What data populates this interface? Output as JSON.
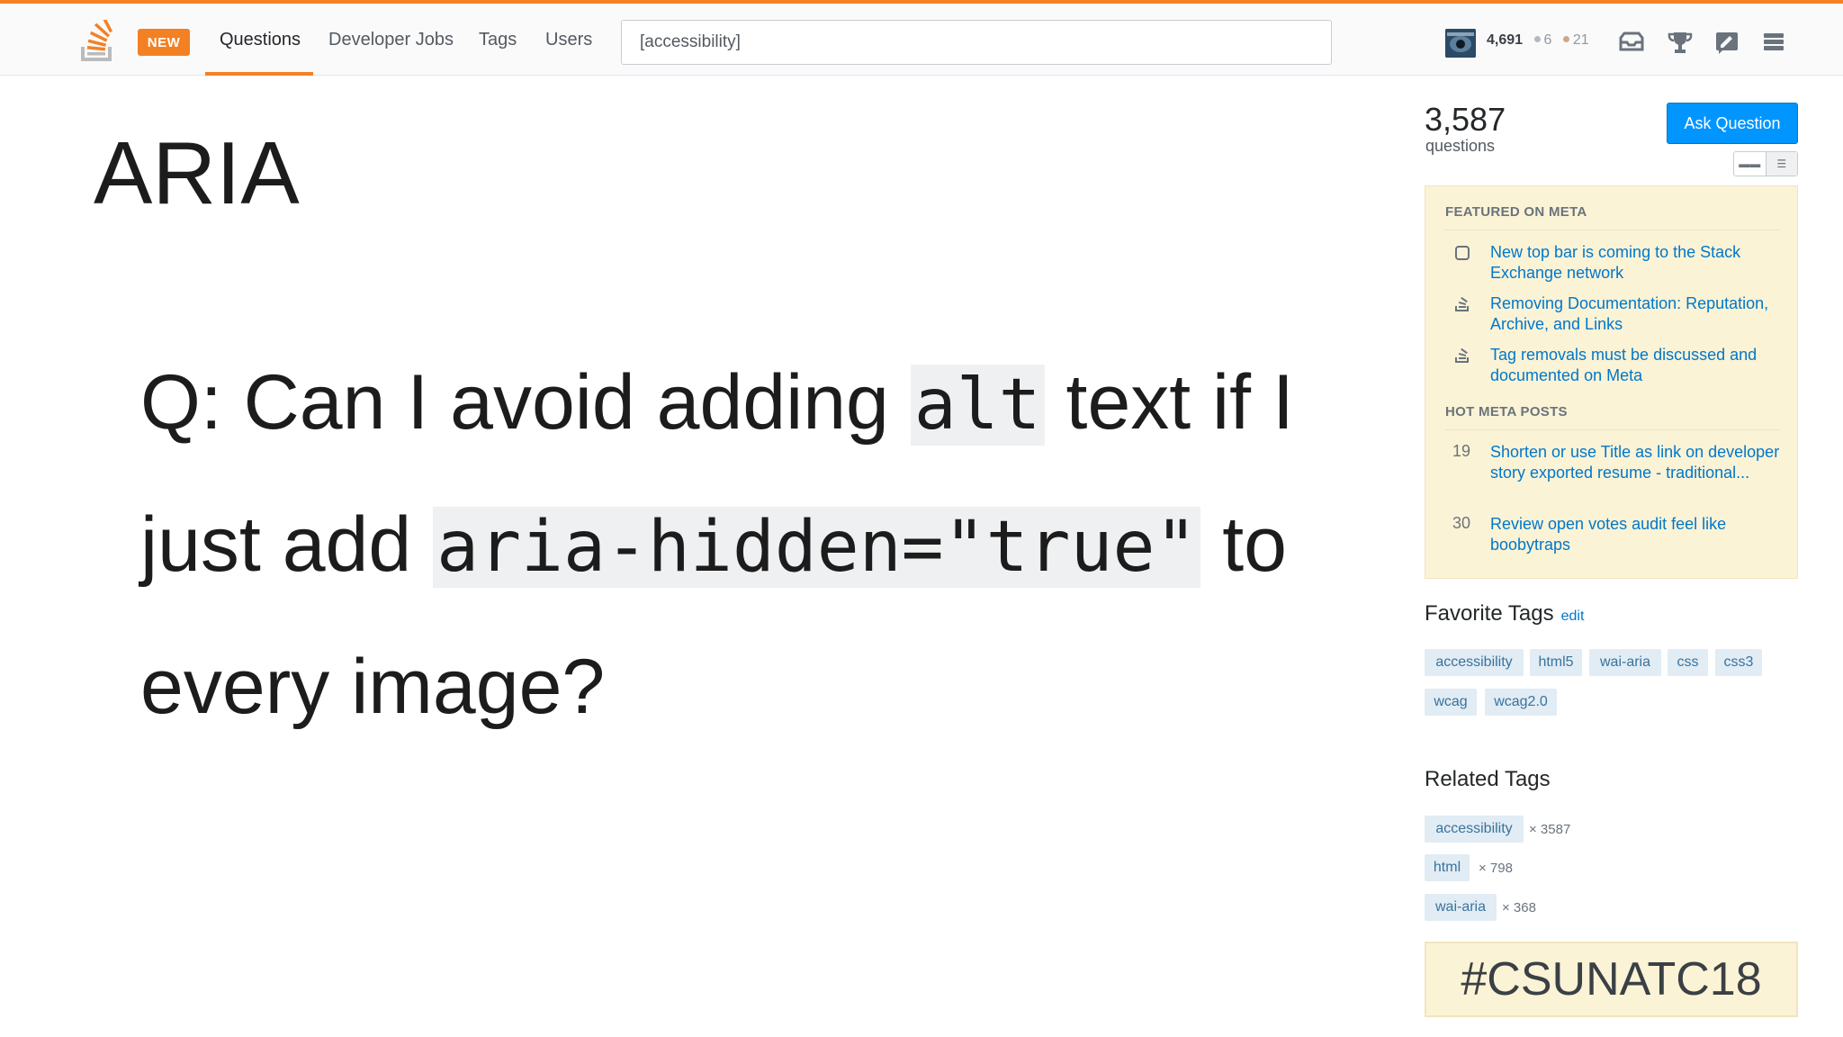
{
  "topbar": {
    "new_badge": "NEW",
    "nav": [
      "Questions",
      "Developer Jobs",
      "Tags",
      "Users"
    ],
    "search_value": "[accessibility]",
    "reputation": "4,691",
    "silver_badges": "6",
    "bronze_badges": "21",
    "colors": {
      "accent": "#f48024",
      "silver": "#b4b8bc",
      "bronze": "#d1a684"
    }
  },
  "slide": {
    "title": "ARIA",
    "q_prefix": "Q: Can I avoid adding ",
    "q_code1": "alt",
    "q_mid": " text if I just add ",
    "q_code2": "aria-hidden=\"true\"",
    "q_suffix": " to every image?"
  },
  "sidebar": {
    "question_count": "3,587",
    "question_label": "questions",
    "ask_button": "Ask Question",
    "featured_heading": "FEATURED ON META",
    "featured": [
      "New top bar is coming to the Stack Exchange network",
      "Removing Documentation: Reputation, Archive, and Links",
      "Tag removals must be discussed and documented on Meta"
    ],
    "hot_heading": "HOT META POSTS",
    "hot": [
      {
        "count": "19",
        "title": "Shorten or use Title as link on developer story exported resume - traditional..."
      },
      {
        "count": "30",
        "title": "Review open votes audit feel like boobytraps"
      }
    ],
    "favorite_title": "Favorite Tags",
    "favorite_edit": "edit",
    "favorite_tags": [
      "accessibility",
      "html5",
      "wai-aria",
      "css",
      "css3",
      "wcag",
      "wcag2.0"
    ],
    "related_title": "Related Tags",
    "related_tags": [
      {
        "name": "accessibility",
        "count": "× 3587"
      },
      {
        "name": "html",
        "count": "× 798"
      },
      {
        "name": "wai-aria",
        "count": "× 368"
      }
    ],
    "hashtag": "#CSUNATC18"
  }
}
